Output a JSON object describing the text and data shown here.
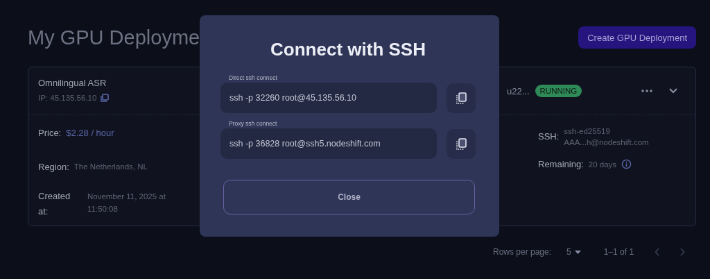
{
  "page": {
    "title": "My GPU Deployme",
    "create_button": "Create GPU Deployment"
  },
  "deployment": {
    "name": "Omnilingual ASR",
    "ip": "IP: 45.135.56.10",
    "image_fragment": "u22...",
    "status": "RUNNING",
    "details_left": [
      {
        "label": "Price:",
        "value": "$2.28 / hour",
        "kind": "price"
      },
      {
        "label": "Region:",
        "value": "The Netherlands, NL",
        "kind": "text"
      },
      {
        "label": "Created at:",
        "value": "November 11, 2025 at 11:50:08",
        "kind": "text"
      }
    ],
    "details_right": [
      {
        "label": "SSH:",
        "value": "ssh-ed25519 AAA...h@nodeshift.com",
        "info": false
      },
      {
        "label": "Remaining:",
        "value": "20 days",
        "info": true
      }
    ]
  },
  "pagination": {
    "rows_label": "Rows per page:",
    "rows_value": "5",
    "range": "1–1 of 1"
  },
  "dialog": {
    "title": "Connect with SSH",
    "fields": [
      {
        "label": "Direct ssh connect",
        "value": "ssh -p 32260 root@45.135.56.10"
      },
      {
        "label": "Proxy ssh connect",
        "value": "ssh -p 36828 root@ssh5.nodeshift.com"
      }
    ],
    "close_button": "Close"
  }
}
